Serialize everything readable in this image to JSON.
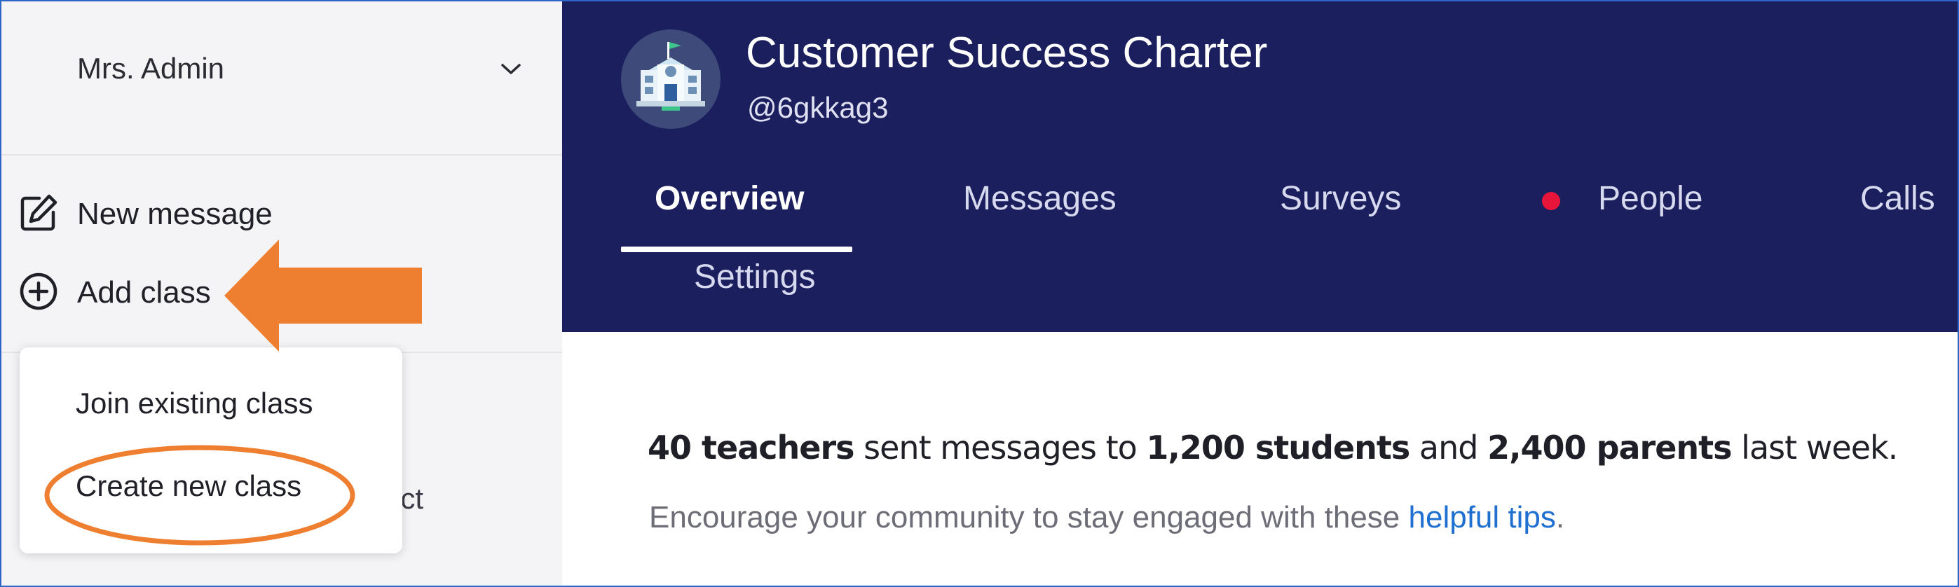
{
  "sidebar": {
    "account_name": "Mrs. Admin",
    "chevron_icon": "chevron-down-icon",
    "new_message": {
      "label": "New message",
      "icon": "edit-icon"
    },
    "add_class": {
      "label": "Add class",
      "icon": "plus-circle-icon"
    },
    "hidden_item_fragment": "ict",
    "dropdown": {
      "join_existing": "Join existing class",
      "create_new": "Create new class"
    }
  },
  "annotations": {
    "color": "#ef7f30"
  },
  "header": {
    "org_name": "Customer Success Charter",
    "org_handle": "@6gkkag3",
    "logo_icon": "school-building-icon",
    "background": "#1c1f5e",
    "tabs": [
      {
        "label": "Overview",
        "active": true
      },
      {
        "label": "Messages"
      },
      {
        "label": "Surveys"
      },
      {
        "label": "People",
        "alert": true
      },
      {
        "label": "Calls"
      },
      {
        "label": "Settings"
      }
    ]
  },
  "main": {
    "summary": {
      "teachers": "40 teachers",
      "text1": " sent messages to ",
      "students": "1,200 students",
      "text2": " and ",
      "parents": "2,400 parents",
      "text3": " last week."
    },
    "tips": {
      "text": "Encourage your community to stay engaged with these ",
      "link": "helpful tips",
      "end": "."
    }
  }
}
